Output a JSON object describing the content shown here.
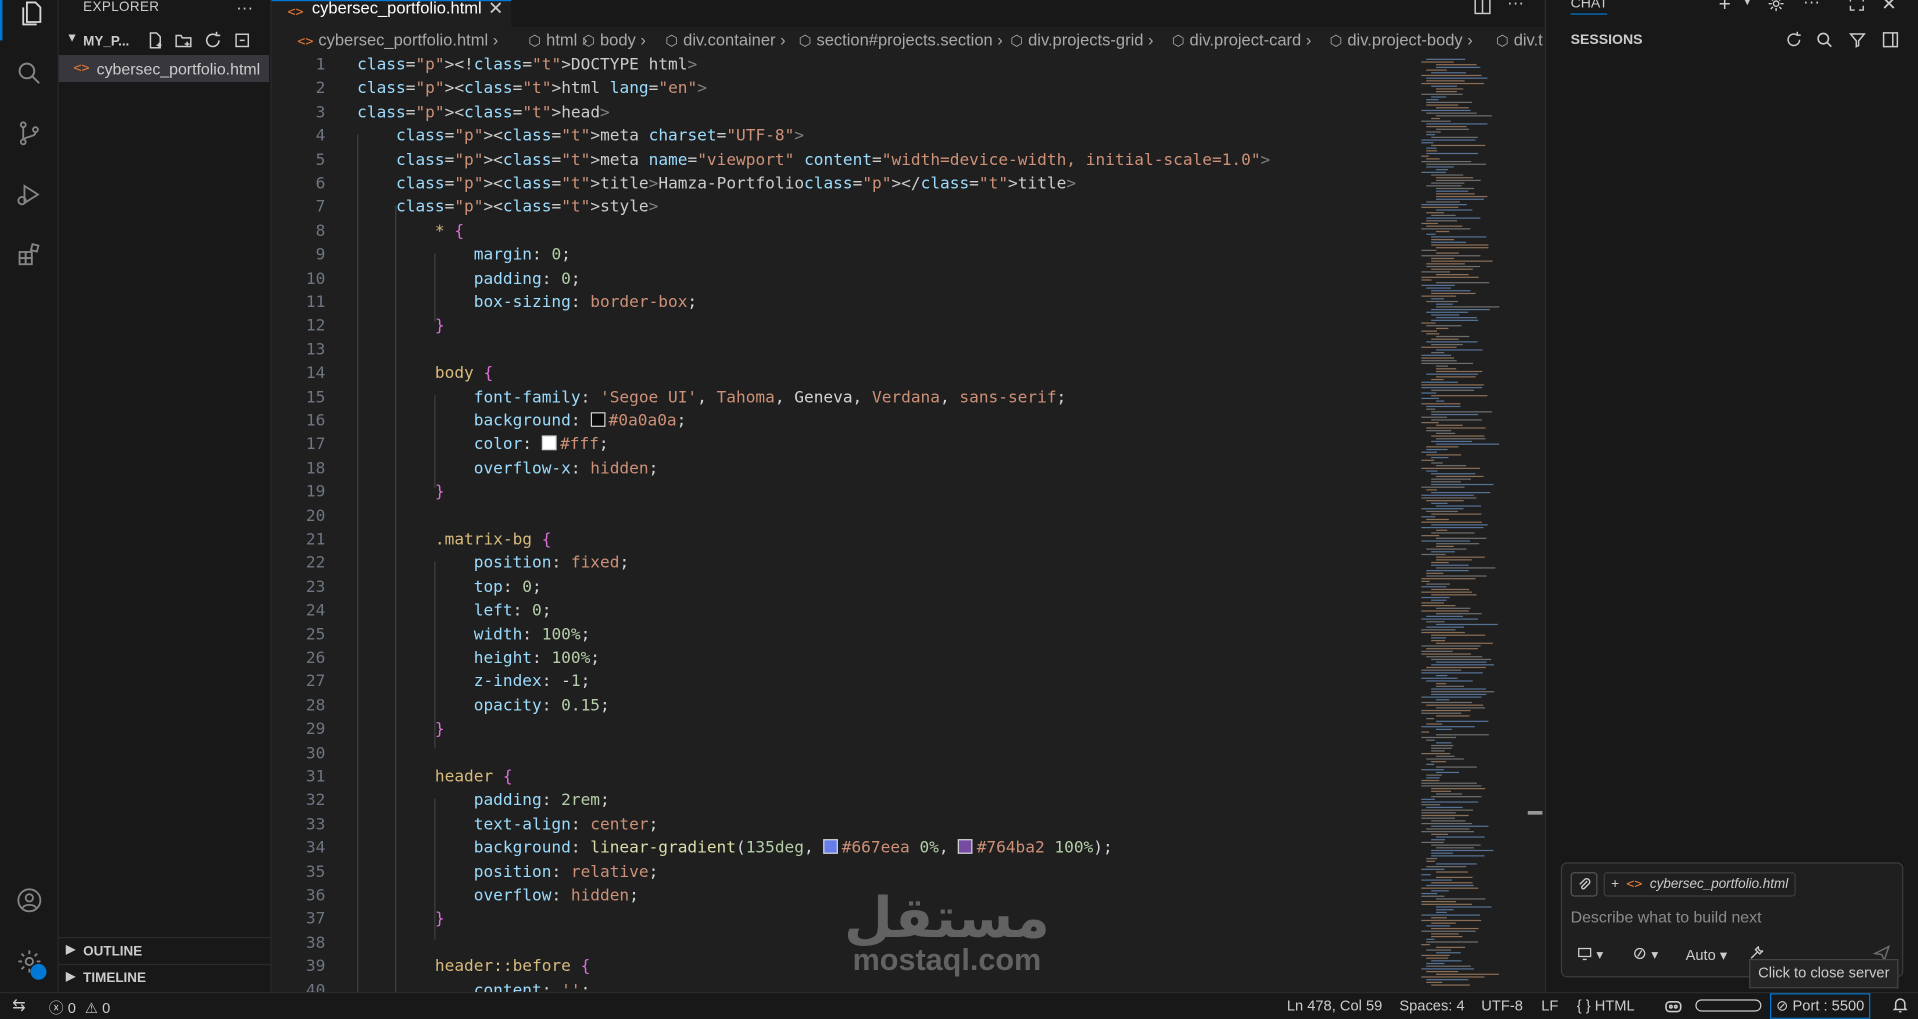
{
  "activity_bar": {
    "icons": [
      "files-icon",
      "search-icon",
      "source-control-icon",
      "run-debug-icon",
      "extensions-icon",
      "account-icon",
      "settings-gear-icon"
    ]
  },
  "sidebar": {
    "title": "EXPLORER",
    "folder": "MY_P...",
    "file": "cybersec_portfolio.html",
    "outline": "OUTLINE",
    "timeline": "TIMELINE"
  },
  "editor": {
    "tab_label": "cybersec_portfolio.html",
    "breadcrumb": [
      "cybersec_portfolio.html",
      "html",
      "body",
      "div.container",
      "section#projects.section",
      "div.projects-grid",
      "div.project-card",
      "div.project-body",
      "div.t"
    ],
    "first_line": 1,
    "lines": [
      "<!DOCTYPE html>",
      "<html lang=\"en\">",
      "<head>",
      "    <meta charset=\"UTF-8\">",
      "    <meta name=\"viewport\" content=\"width=device-width, initial-scale=1.0\">",
      "    <title>Hamza-Portfolio</title>",
      "    <style>",
      "        * {",
      "            margin: 0;",
      "            padding: 0;",
      "            box-sizing: border-box;",
      "        }",
      "",
      "        body {",
      "            font-family: 'Segoe UI', Tahoma, Geneva, Verdana, sans-serif;",
      "            background: #0a0a0a;",
      "            color: #fff;",
      "            overflow-x: hidden;",
      "        }",
      "",
      "        .matrix-bg {",
      "            position: fixed;",
      "            top: 0;",
      "            left: 0;",
      "            width: 100%;",
      "            height: 100%;",
      "            z-index: -1;",
      "            opacity: 0.15;",
      "        }",
      "",
      "        header {",
      "            padding: 2rem;",
      "            text-align: center;",
      "            background: linear-gradient(135deg, #667eea 0%, #764ba2 100%);",
      "            position: relative;",
      "            overflow: hidden;",
      "        }",
      "",
      "        header::before {",
      "            content: '';"
    ]
  },
  "chat": {
    "title": "CHAT",
    "sessions_label": "SESSIONS",
    "attachment": "cybersec_portfolio.html",
    "placeholder": "Describe what to build next",
    "mode": "Auto",
    "tooltip": "Click to close server"
  },
  "status_bar": {
    "errors": "0",
    "warnings": "0",
    "position": "Ln 478, Col 59",
    "spaces": "Spaces: 4",
    "encoding": "UTF-8",
    "eol": "LF",
    "language": "HTML",
    "port": "Port : 5500"
  },
  "watermark": {
    "arabic": "مستقل",
    "latin": "mostaql.com"
  },
  "colors": {
    "accent": "#0078d4",
    "background": "#1f1f1f",
    "sidebar": "#181818"
  }
}
